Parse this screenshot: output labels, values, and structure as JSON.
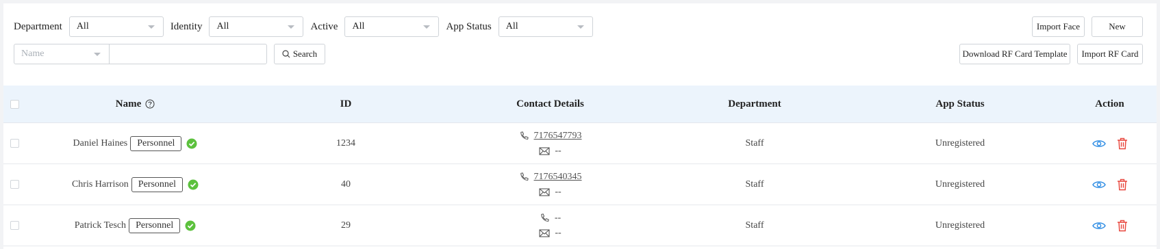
{
  "filters": {
    "department_label": "Department",
    "department_value": "All",
    "identity_label": "Identity",
    "identity_value": "All",
    "active_label": "Active",
    "active_value": "All",
    "app_status_label": "App Status",
    "app_status_value": "All",
    "search_field_placeholder": "Name",
    "search_input_value": "",
    "search_button": "Search"
  },
  "actions": {
    "import_face": "Import Face",
    "new": "New",
    "download_template": "Download RF Card Template",
    "import_rf_card": "Import RF Card"
  },
  "table": {
    "headers": {
      "name": "Name",
      "id": "ID",
      "contact": "Contact Details",
      "department": "Department",
      "app_status": "App Status",
      "action": "Action"
    },
    "rows": [
      {
        "name": "Daniel Haines",
        "tag": "Personnel",
        "id": "1234",
        "phone": "7176547793",
        "email": "--",
        "department": "Staff",
        "app_status": "Unregistered"
      },
      {
        "name": "Chris Harrison",
        "tag": "Personnel",
        "id": "40",
        "phone": "7176540345",
        "email": "--",
        "department": "Staff",
        "app_status": "Unregistered"
      },
      {
        "name": "Patrick Tesch",
        "tag": "Personnel",
        "id": "29",
        "phone": "--",
        "email": "--",
        "department": "Staff",
        "app_status": "Unregistered"
      }
    ]
  },
  "colors": {
    "header_bg": "#ecf4fc",
    "view_icon": "#2f8de4",
    "delete_icon": "#e8443a",
    "ok_icon": "#5cc13d"
  }
}
